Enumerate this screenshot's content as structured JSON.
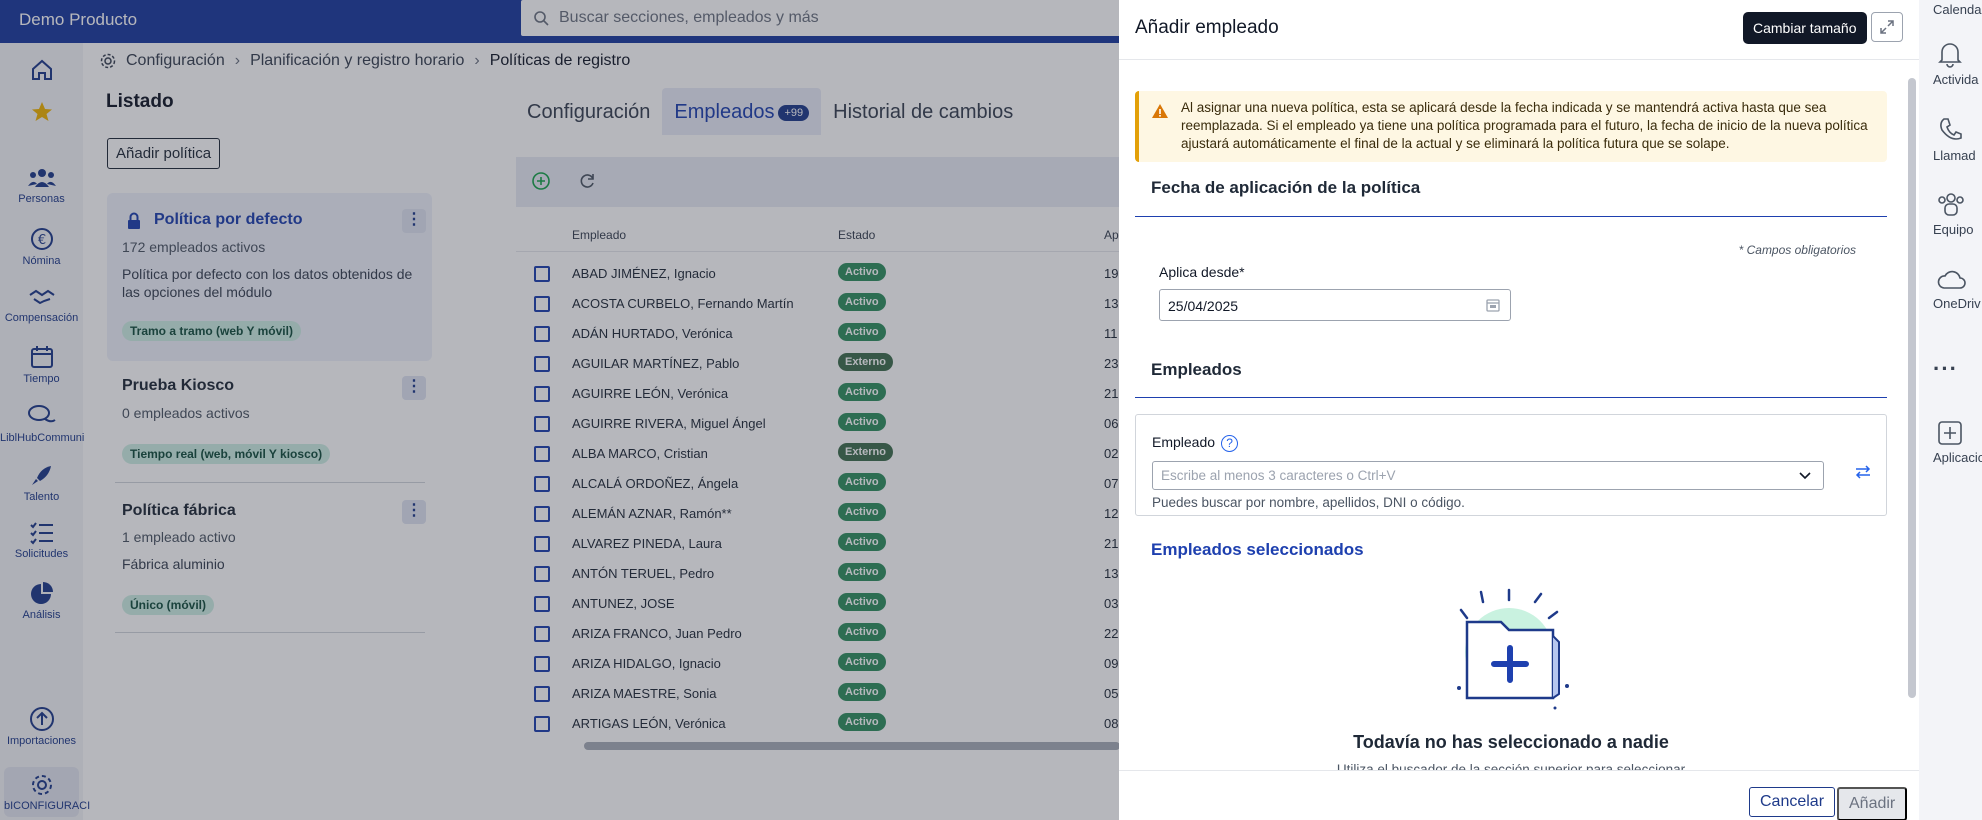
{
  "topbar": {
    "brand": "Demo Producto",
    "search_placeholder": "Buscar secciones, empleados y más"
  },
  "leftnav": [
    {
      "label": "",
      "icon": "home-icon"
    },
    {
      "label": "",
      "icon": "star-icon"
    },
    {
      "label": "Personas",
      "icon": "people-icon"
    },
    {
      "label": "Nómina",
      "icon": "euro-icon"
    },
    {
      "label": "Compensación",
      "icon": "handshake-icon"
    },
    {
      "label": "Tiempo",
      "icon": "calendar-icon"
    },
    {
      "label": "LiblHubCommuni",
      "icon": "chat-icon"
    },
    {
      "label": "Talento",
      "icon": "rocket-icon"
    },
    {
      "label": "Solicitudes",
      "icon": "checklist-icon"
    },
    {
      "label": "Análisis",
      "icon": "pie-chart-icon"
    },
    {
      "label": "Importaciones",
      "icon": "upload-icon"
    },
    {
      "label": "bICONFIGURACI",
      "icon": "gear-icon"
    }
  ],
  "breadcrumb": [
    "Configuración",
    "Planificación y registro horario",
    "Políticas de registro"
  ],
  "listado": {
    "title": "Listado",
    "add_button": "Añadir política",
    "policies": [
      {
        "title": "Política por defecto",
        "sub": "172 empleados activos",
        "desc": "Política por defecto con los datos obtenidos de las opciones del módulo",
        "tag": "Tramo a tramo (web Y móvil)"
      },
      {
        "title": "Prueba Kiosco",
        "sub": "0 empleados activos",
        "desc": "",
        "tag": "Tiempo real (web, móvil Y kiosco)"
      },
      {
        "title": "Política fábrica",
        "sub": "1 empleado activo",
        "desc": "Fábrica aluminio",
        "tag": "Único (móvil)"
      }
    ]
  },
  "tabs": [
    {
      "label": "Configuración"
    },
    {
      "label": "Empleados",
      "badge": "+99"
    },
    {
      "label": "Historial de cambios"
    }
  ],
  "grid": {
    "headers": [
      "Empleado",
      "Estado",
      "Ap"
    ],
    "rows": [
      {
        "name": "ABAD JIMÉNEZ, Ignacio",
        "status": "Activo",
        "ap": "19"
      },
      {
        "name": "ACOSTA CURBELO, Fernando Martín",
        "status": "Activo",
        "ap": "13"
      },
      {
        "name": "ADÁN HURTADO, Verónica",
        "status": "Activo",
        "ap": "11"
      },
      {
        "name": "AGUILAR MARTÍNEZ, Pablo",
        "status": "Externo",
        "ap": "23"
      },
      {
        "name": "AGUIRRE LEÓN, Verónica",
        "status": "Activo",
        "ap": "21"
      },
      {
        "name": "AGUIRRE RIVERA, Miguel Ángel",
        "status": "Activo",
        "ap": "06"
      },
      {
        "name": "ALBA MARCO, Cristian",
        "status": "Externo",
        "ap": "02"
      },
      {
        "name": "ALCALÁ ORDOÑEZ, Ángela",
        "status": "Activo",
        "ap": "07"
      },
      {
        "name": "ALEMÁN AZNAR, Ramón**",
        "status": "Activo",
        "ap": "12"
      },
      {
        "name": "ALVAREZ PINEDA, Laura",
        "status": "Activo",
        "ap": "21"
      },
      {
        "name": "ANTÓN TERUEL, Pedro",
        "status": "Activo",
        "ap": "13"
      },
      {
        "name": "ANTUNEZ, JOSE",
        "status": "Activo",
        "ap": "03"
      },
      {
        "name": "ARIZA FRANCO, Juan Pedro",
        "status": "Activo",
        "ap": "22"
      },
      {
        "name": "ARIZA HIDALGO, Ignacio",
        "status": "Activo",
        "ap": "09"
      },
      {
        "name": "ARIZA MAESTRE, Sonia",
        "status": "Activo",
        "ap": "05"
      },
      {
        "name": "ARTIGAS LEÓN, Verónica",
        "status": "Activo",
        "ap": "08"
      }
    ]
  },
  "panel": {
    "title": "Añadir empleado",
    "tooltip": "Cambiar tamaño",
    "warning": "Al asignar una nueva política, esta se aplicará desde la fecha indicada y se mantendrá activa hasta que sea reemplazada. Si el empleado ya tiene una política programada para el futuro, la fecha de inicio de la nueva política ajustará automáticamente el final de la actual y se eliminará la política futura que se solape.",
    "section_date": "Fecha de aplicación de la política",
    "required_note": "* Campos obligatorios",
    "date_label": "Aplica desde*",
    "date_value": "25/04/2025",
    "section_employees": "Empleados",
    "employee_label": "Empleado",
    "employee_placeholder": "Escribe al menos 3 caracteres o Ctrl+V",
    "employee_hint": "Puedes buscar por nombre, apellidos, DNI o código.",
    "selected_title": "Empleados seleccionados",
    "empty_title": "Todavía no has seleccionado a nadie",
    "empty_sub": "Utiliza el buscador de la sección superior para seleccionar",
    "cancel": "Cancelar",
    "add": "Añadir"
  },
  "rightrail": [
    {
      "label": "Calenda",
      "icon": "calendar-icon"
    },
    {
      "label": "Activida",
      "icon": "bell-icon"
    },
    {
      "label": "Llamad",
      "icon": "phone-icon"
    },
    {
      "label": "Equipo",
      "icon": "team-icon"
    },
    {
      "label": "OneDriv",
      "icon": "cloud-icon"
    },
    {
      "label": "",
      "icon": "more-icon"
    },
    {
      "label": "Aplicacio",
      "icon": "add-app-icon"
    }
  ],
  "colors": {
    "brand": "#1b3a9e",
    "accent": "#1e40af",
    "active_status": "#2f8f5f",
    "warning": "#e3a008"
  }
}
